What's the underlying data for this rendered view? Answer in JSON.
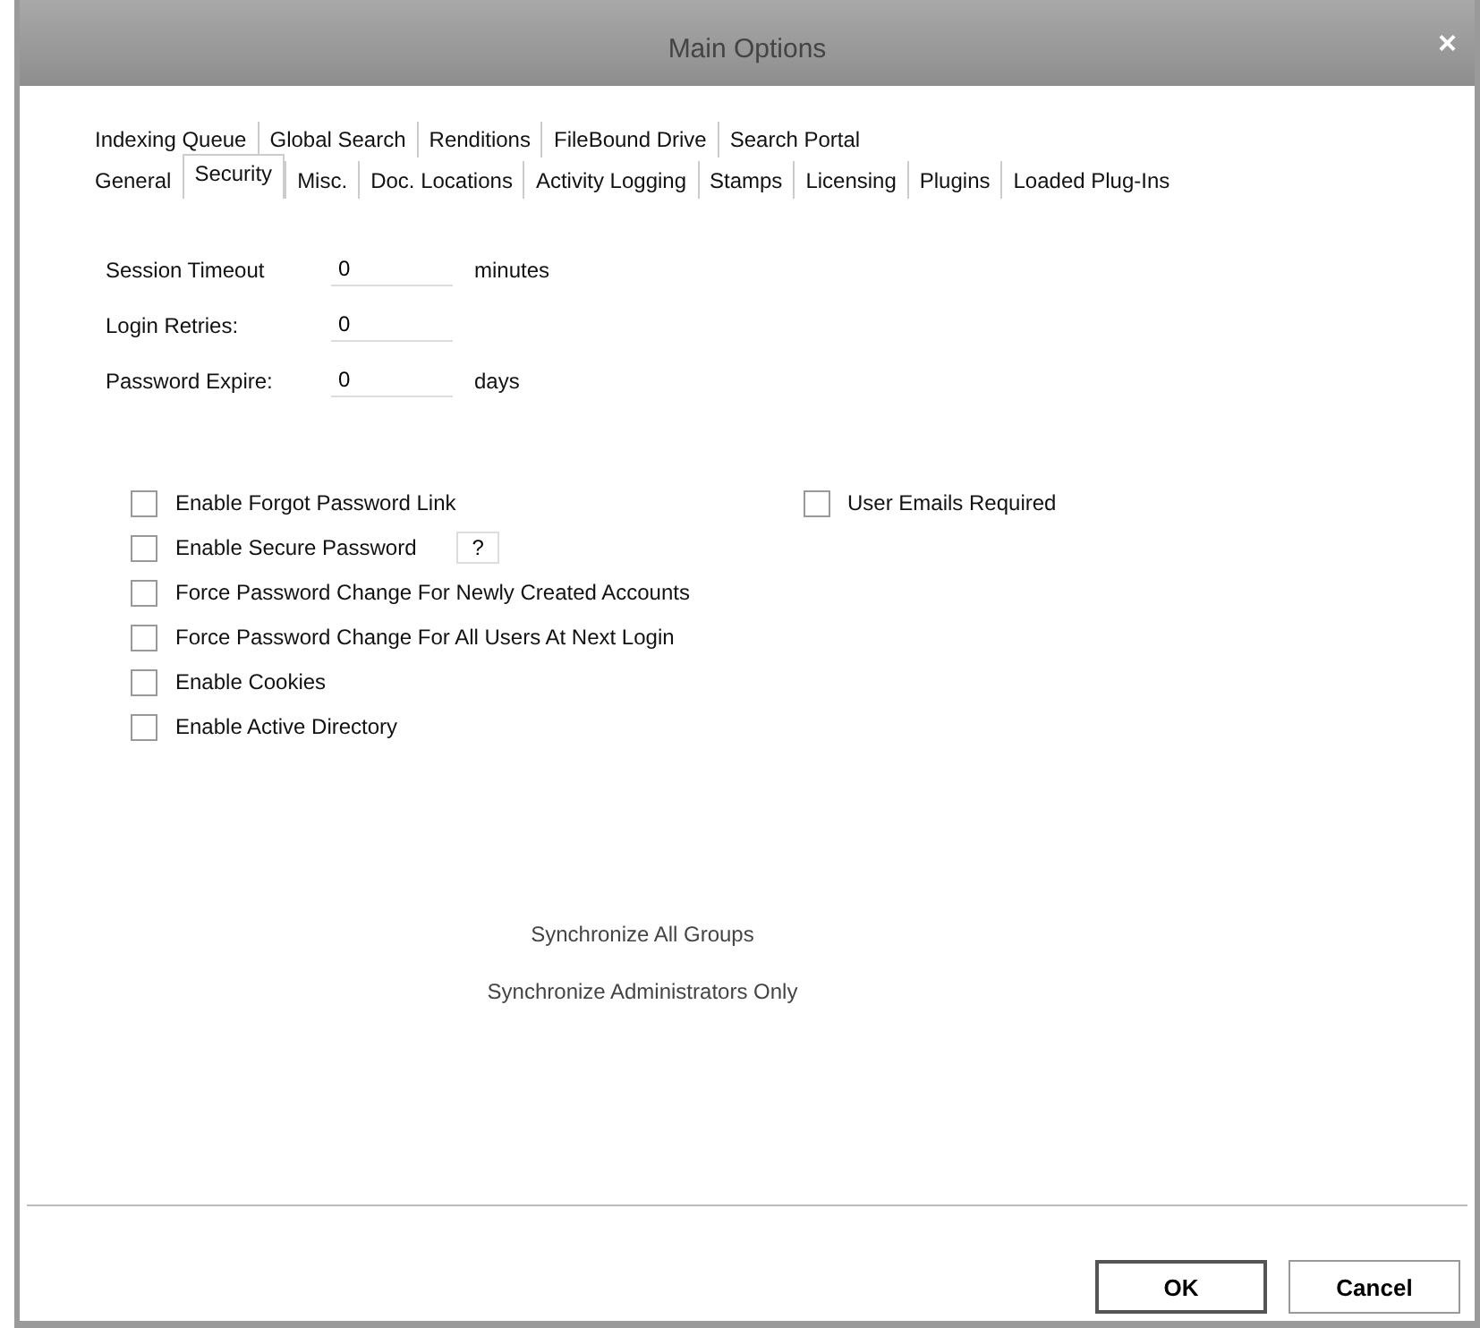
{
  "window": {
    "title": "Main Options",
    "close": "×"
  },
  "tab_rows": [
    {
      "tabs": [
        {
          "label": "Indexing Queue",
          "selected": false
        },
        {
          "label": "Global Search",
          "selected": false
        },
        {
          "label": "Renditions",
          "selected": false
        },
        {
          "label": "FileBound Drive",
          "selected": false
        },
        {
          "label": "Search Portal",
          "selected": false
        }
      ]
    },
    {
      "tabs": [
        {
          "label": "General",
          "selected": false
        },
        {
          "label": "Security",
          "selected": true
        },
        {
          "label": "Misc.",
          "selected": false
        },
        {
          "label": "Doc. Locations",
          "selected": false
        },
        {
          "label": "Activity Logging",
          "selected": false
        },
        {
          "label": "Stamps",
          "selected": false
        },
        {
          "label": "Licensing",
          "selected": false
        },
        {
          "label": "Plugins",
          "selected": false
        },
        {
          "label": "Loaded Plug-Ins",
          "selected": false
        }
      ]
    }
  ],
  "fields": [
    {
      "label": "Session Timeout",
      "value": "0",
      "unit": "minutes"
    },
    {
      "label": "Login Retries:",
      "value": "0"
    },
    {
      "label": "Password Expire:",
      "value": "0",
      "unit": "days"
    }
  ],
  "checkboxes_left": [
    {
      "label": "Enable Forgot Password Link",
      "checked": false
    },
    {
      "label": "Enable Secure Password",
      "checked": false,
      "help": "?"
    },
    {
      "label": "Force Password Change For Newly Created Accounts",
      "checked": false
    },
    {
      "label": "Force Password Change For All Users At Next Login",
      "checked": false
    },
    {
      "label": "Enable Cookies",
      "checked": false
    },
    {
      "label": "Enable Active Directory",
      "checked": false
    }
  ],
  "checkboxes_right": [
    {
      "label": "User Emails Required",
      "checked": false
    }
  ],
  "sync_options": [
    "Synchronize All Groups",
    "Synchronize Administrators Only"
  ],
  "buttons": [
    "OK",
    "Cancel"
  ]
}
